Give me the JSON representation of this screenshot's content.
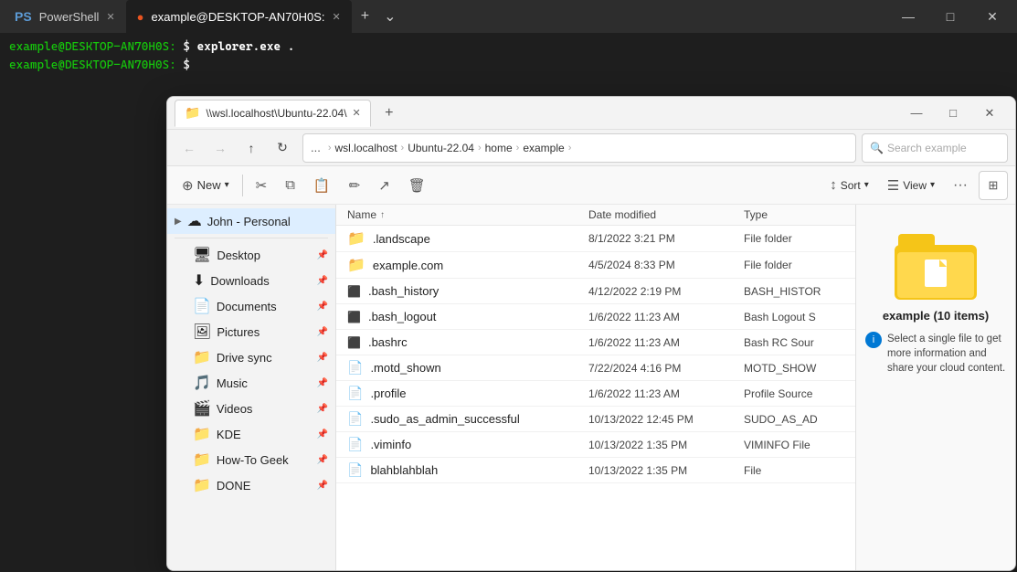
{
  "terminal": {
    "tabs": [
      {
        "label": "PowerShell",
        "icon": "ps",
        "active": false,
        "closable": true
      },
      {
        "label": "example@DESKTOP-AN70H0S:",
        "icon": "ubuntu",
        "active": true,
        "closable": true
      }
    ],
    "lines": [
      {
        "prompt": "example@DESKTOP-AN70H0S:",
        "dollar": " $",
        "command": " explorer.exe ."
      },
      {
        "prompt": "example@DESKTOP-AN70H0S:",
        "dollar": " $",
        "command": ""
      }
    ]
  },
  "explorer": {
    "title": "\\\\wsl.localhost\\Ubuntu-22.04\\",
    "search_placeholder": "Search example",
    "address": {
      "dots": "...",
      "parts": [
        "wsl.localhost",
        "Ubuntu-22.04",
        "home",
        "example"
      ]
    },
    "toolbar": {
      "new_label": "New",
      "sort_label": "Sort",
      "view_label": "View"
    },
    "sidebar": {
      "top_item": {
        "label": "John - Personal",
        "icon": "☁"
      },
      "items": [
        {
          "label": "Desktop",
          "icon": "🖥",
          "pinned": true
        },
        {
          "label": "Downloads",
          "icon": "⬇",
          "pinned": true
        },
        {
          "label": "Documents",
          "icon": "📄",
          "pinned": true
        },
        {
          "label": "Pictures",
          "icon": "🖼",
          "pinned": true
        },
        {
          "label": "Drive sync",
          "icon": "📁",
          "pinned": true
        },
        {
          "label": "Music",
          "icon": "🎵",
          "pinned": true
        },
        {
          "label": "Videos",
          "icon": "🎬",
          "pinned": true
        },
        {
          "label": "KDE",
          "icon": "📁",
          "pinned": true
        },
        {
          "label": "How-To Geek",
          "icon": "📁",
          "pinned": true
        },
        {
          "label": "DONE",
          "icon": "📁",
          "pinned": true
        }
      ]
    },
    "columns": {
      "name": "Name",
      "modified": "Date modified",
      "type": "Type"
    },
    "files": [
      {
        "icon": "📁",
        "name": ".landscape",
        "modified": "8/1/2022 3:21 PM",
        "type": "File folder",
        "color": "#ffc107"
      },
      {
        "icon": "📁",
        "name": "example.com",
        "modified": "4/5/2024 8:33 PM",
        "type": "File folder",
        "color": "#ffc107"
      },
      {
        "icon": "📄",
        "name": ".bash_history",
        "modified": "4/12/2022 2:19 PM",
        "type": "BASH_HISTOR"
      },
      {
        "icon": "📄",
        "name": ".bash_logout",
        "modified": "1/6/2022 11:23 AM",
        "type": "Bash Logout S"
      },
      {
        "icon": "📄",
        "name": ".bashrc",
        "modified": "1/6/2022 11:23 AM",
        "type": "Bash RC Sour"
      },
      {
        "icon": "📄",
        "name": ".motd_shown",
        "modified": "7/22/2024 4:16 PM",
        "type": "MOTD_SHOW"
      },
      {
        "icon": "📄",
        "name": ".profile",
        "modified": "1/6/2022 11:23 AM",
        "type": "Profile Source"
      },
      {
        "icon": "📄",
        "name": ".sudo_as_admin_successful",
        "modified": "10/13/2022 12:45 PM",
        "type": "SUDO_AS_AD"
      },
      {
        "icon": "📄",
        "name": ".viminfo",
        "modified": "10/13/2022 1:35 PM",
        "type": "VIMINFO File"
      },
      {
        "icon": "📄",
        "name": "blahblahblah",
        "modified": "10/13/2022 1:35 PM",
        "type": "File"
      }
    ],
    "preview": {
      "title": "example (10 items)",
      "info": "Select a single file to get more information and share your cloud content."
    }
  },
  "icons": {
    "back": "←",
    "forward": "→",
    "up": "↑",
    "refresh": "↻",
    "monitor": "⊞",
    "chevron_right": "›",
    "sort_arrow": "↑",
    "pin": "📌",
    "new_plus": "+",
    "scissors": "✂",
    "copy_icon": "⧉",
    "paste_icon": "📋",
    "rename_icon": "✏",
    "share_icon": "↗",
    "delete_icon": "🗑",
    "more_icon": "…",
    "layout_icon": "⊞",
    "minimize": "—",
    "maximize": "□",
    "close": "✕"
  }
}
